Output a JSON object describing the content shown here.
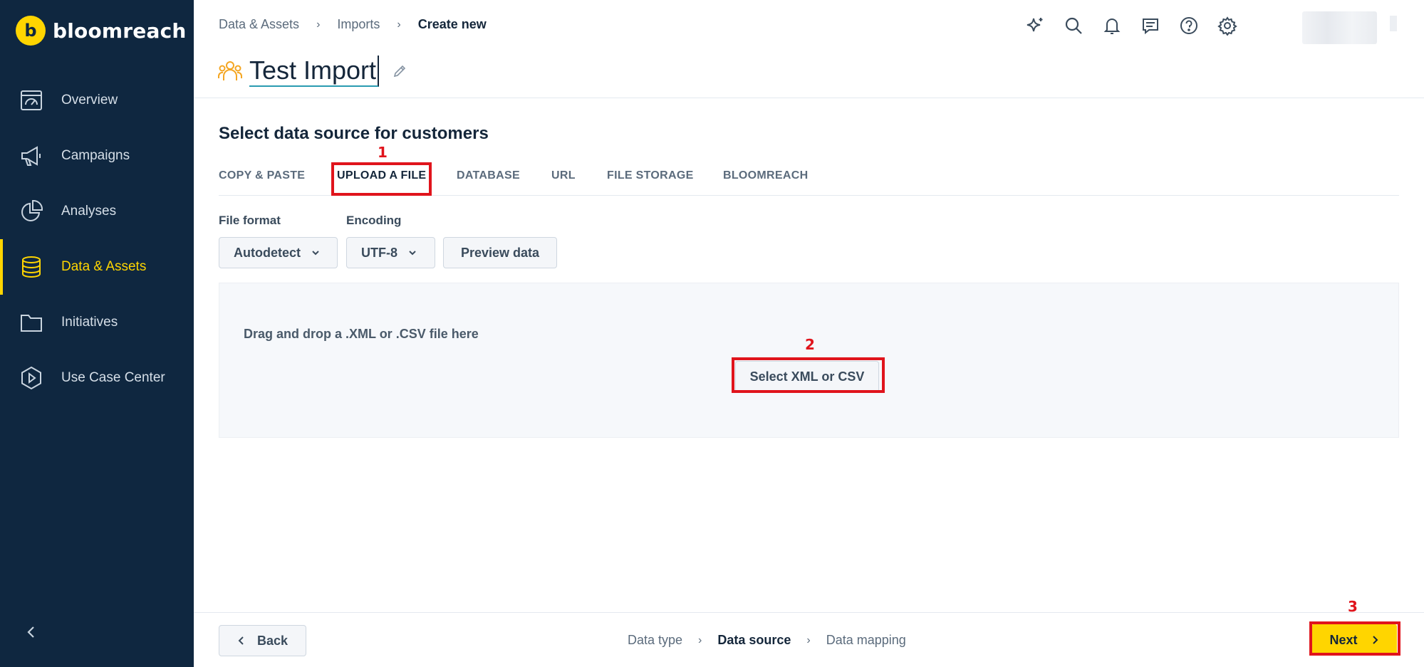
{
  "sidebar": {
    "logo_mark": "b",
    "logo_text": "bloomreach",
    "items": [
      {
        "label": "Overview",
        "icon": "dashboard-icon"
      },
      {
        "label": "Campaigns",
        "icon": "megaphone-icon"
      },
      {
        "label": "Analyses",
        "icon": "pie-chart-icon"
      },
      {
        "label": "Data & Assets",
        "icon": "database-icon",
        "active": true
      },
      {
        "label": "Initiatives",
        "icon": "folder-icon"
      },
      {
        "label": "Use Case Center",
        "icon": "play-hexagon-icon"
      }
    ],
    "collapse_icon": "chevron-left-icon"
  },
  "header": {
    "breadcrumb": [
      "Data & Assets",
      "Imports",
      "Create new"
    ],
    "title": "Test Import",
    "icons": [
      "sparkle-icon",
      "search-icon",
      "bell-icon",
      "chat-icon",
      "help-icon",
      "gear-icon"
    ]
  },
  "main": {
    "section_title": "Select data source for customers",
    "tabs": [
      "COPY & PASTE",
      "UPLOAD A FILE",
      "DATABASE",
      "URL",
      "FILE STORAGE",
      "BLOOMREACH"
    ],
    "active_tab": "UPLOAD A FILE",
    "file_format_label": "File format",
    "file_format_value": "Autodetect",
    "encoding_label": "Encoding",
    "encoding_value": "UTF-8",
    "preview_button": "Preview data",
    "drop_text": "Drag and drop a .XML or .CSV file here",
    "select_button": "Select XML or CSV"
  },
  "annotations": {
    "m1": "1",
    "m2": "2",
    "m3": "3"
  },
  "footer": {
    "back_label": "Back",
    "steps": [
      "Data type",
      "Data source",
      "Data mapping"
    ],
    "current_step": "Data source",
    "next_label": "Next"
  },
  "colors": {
    "sidebar_bg": "#0f2740",
    "accent": "#ffd500",
    "highlight": "#e0141c"
  }
}
